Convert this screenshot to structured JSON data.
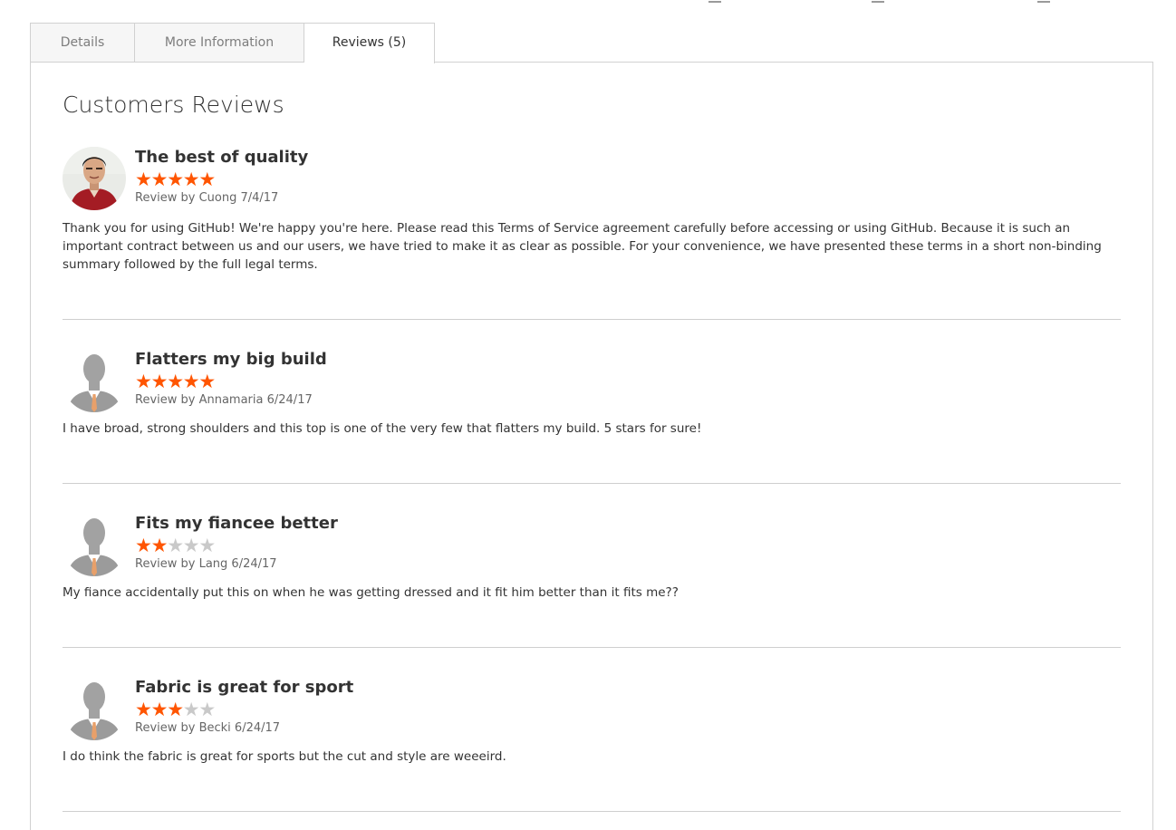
{
  "tabs": [
    {
      "label": "Details"
    },
    {
      "label": "More Information"
    },
    {
      "label": "Reviews (5)"
    }
  ],
  "panel": {
    "title": "Customers Reviews"
  },
  "reviews": [
    {
      "title": "The best of quality",
      "rating": 5,
      "max_rating": 5,
      "byline": "Review by Cuong 7/4/17",
      "avatar": "photo",
      "text": "Thank you for using GitHub! We're happy you're here. Please read this Terms of Service agreement carefully before accessing or using GitHub. Because it is such an important contract between us and our users, we have tried to make it as clear as possible. For your convenience, we have presented these terms in a short non-binding summary followed by the full legal terms."
    },
    {
      "title": "Flatters my big build",
      "rating": 5,
      "max_rating": 5,
      "byline": "Review by Annamaria 6/24/17",
      "avatar": "silhouette",
      "text": "I have broad, strong shoulders and this top is one of the very few that flatters my build. 5 stars for sure!"
    },
    {
      "title": "Fits my fiancee better",
      "rating": 2,
      "max_rating": 5,
      "byline": "Review by Lang 6/24/17",
      "avatar": "silhouette",
      "text": "My fiance accidentally put this on when he was getting dressed and it fit him better than it fits me??"
    },
    {
      "title": "Fabric is great for sport",
      "rating": 3,
      "max_rating": 5,
      "byline": "Review by Becki 6/24/17",
      "avatar": "silhouette",
      "text": "I do think the fabric is great for sports but the cut and style are weeeird."
    }
  ],
  "colors": {
    "star_on": "#ff5501",
    "star_off": "#c9c9c9",
    "border": "#d1d1d1",
    "text": "#333333"
  }
}
